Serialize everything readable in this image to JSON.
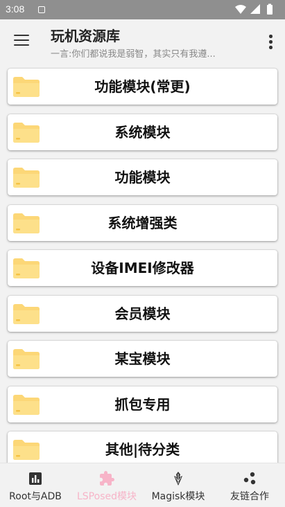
{
  "status_bar": {
    "time": "3:08"
  },
  "app_bar": {
    "title": "玩机资源库",
    "subtitle": "一言:你们都说我是弱智，其实只有我遵..."
  },
  "folders": [
    {
      "label": "功能模块(常更)"
    },
    {
      "label": "系统模块"
    },
    {
      "label": "功能模块"
    },
    {
      "label": "系统增强类"
    },
    {
      "label": "设备IMEI修改器"
    },
    {
      "label": "会员模块"
    },
    {
      "label": "某宝模块"
    },
    {
      "label": "抓包专用"
    },
    {
      "label": "其他|待分类"
    }
  ],
  "bottom_nav": [
    {
      "label": "Root与ADB",
      "icon": "bar-chart-icon",
      "active": false
    },
    {
      "label": "LSPosed模块",
      "icon": "puzzle-icon",
      "active": true
    },
    {
      "label": "Magisk模块",
      "icon": "magisk-icon",
      "active": false
    },
    {
      "label": "友链合作",
      "icon": "share-dots-icon",
      "active": false
    }
  ],
  "colors": {
    "status_bar": "#8f8f8f",
    "background": "#f2f2f2",
    "folder_yellow": "#fcd777",
    "nav_active": "#f7b4c8"
  }
}
